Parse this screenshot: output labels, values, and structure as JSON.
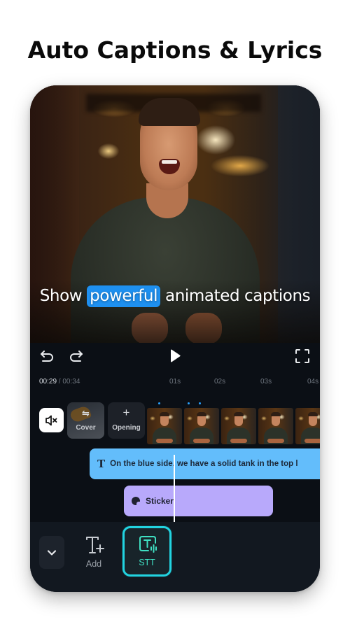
{
  "headline": "Auto Captions & Lyrics",
  "preview": {
    "caption_before": "Show",
    "caption_highlight": "powerful",
    "caption_after": "animated captions",
    "highlight_color": "#1e90f0"
  },
  "controls": {
    "undo_icon": "undo-icon",
    "redo_icon": "redo-icon",
    "play_icon": "play-icon",
    "fullscreen_icon": "fullscreen-icon"
  },
  "timeline": {
    "current_time": "00:29",
    "separator": " / ",
    "total_time": "00:34",
    "ticks": [
      "01s",
      "02s",
      "03s",
      "04s"
    ]
  },
  "tracks": {
    "mute_icon": "speaker-mute-icon",
    "cover": {
      "icon": "⇋",
      "label": "Cover"
    },
    "opening": {
      "icon": "+",
      "label": "Opening"
    },
    "frame_count": 5,
    "text_clip": {
      "icon": "T",
      "label": "On the blue side,  we have a solid tank in the top l",
      "color": "#63bdfb"
    },
    "sticker_clip": {
      "label": "Sticker",
      "color": "#b8a9fb"
    }
  },
  "toolbar": {
    "collapse_icon": "chevron-down-icon",
    "add_label": "Add",
    "stt_label": "STT",
    "stt_accent": "#22d3e0"
  }
}
